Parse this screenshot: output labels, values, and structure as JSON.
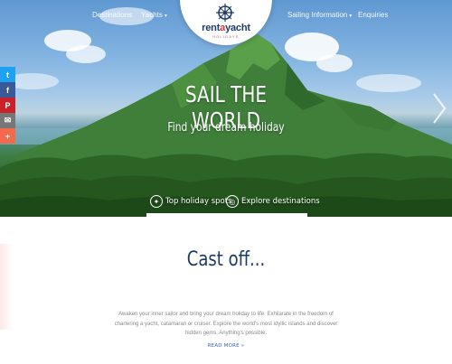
{
  "nav": {
    "left_items": [
      {
        "label": "Destinations",
        "has_caret": false
      },
      {
        "label": "Yachts",
        "has_caret": true
      }
    ],
    "right_items": [
      {
        "label": "Sailing Information",
        "has_caret": true
      },
      {
        "label": "Enquiries",
        "has_caret": false
      }
    ]
  },
  "logo": {
    "word_part1": "rent",
    "word_mark": "a",
    "word_part2": "yacht",
    "sub": "HOLIDAYS"
  },
  "hero": {
    "title": "SAIL THE WORLD",
    "subtitle": "Find your dream holiday",
    "links": [
      {
        "label": "Top holiday spots",
        "icon": "compass-icon"
      },
      {
        "label": "Explore destinations",
        "icon": "globe-icon"
      }
    ],
    "next_arrow": "chevron-right-icon"
  },
  "share": [
    {
      "icon": "twitter-icon",
      "glyph": "t",
      "color": "#1da1f2"
    },
    {
      "icon": "facebook-icon",
      "glyph": "f",
      "color": "#3b5998"
    },
    {
      "icon": "pinterest-icon",
      "glyph": "P",
      "color": "#cb2027"
    },
    {
      "icon": "email-icon",
      "glyph": "✉",
      "color": "#777777"
    },
    {
      "icon": "plus-icon",
      "glyph": "+",
      "color": "#f26a4b"
    }
  ],
  "section": {
    "title": "Cast off...",
    "body": "Awaken your inner sailor and bring your dream holiday to life. Exhilarate in the freedom of chartering a yacht, catamaran or cruiser. Explore the world's most idyllic islands and discover hidden gems. Anything's possible.",
    "read_more": "READ MORE »"
  },
  "colors": {
    "brand_navy": "#1d3a66",
    "brand_red": "#d33a3a",
    "link_blue": "#3b66a8"
  }
}
